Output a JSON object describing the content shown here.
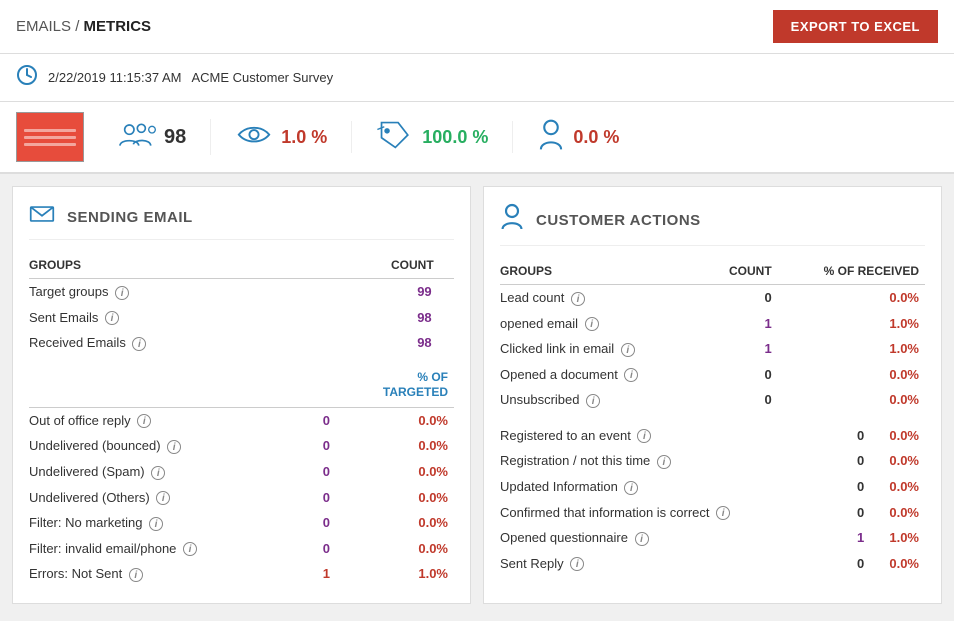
{
  "header": {
    "breadcrumb_emails": "EMAILS",
    "breadcrumb_sep": " /  ",
    "breadcrumb_metrics": "METRICS",
    "export_btn": "EXPORT TO EXCEL"
  },
  "info_bar": {
    "datetime": "2/22/2019  11:15:37 AM",
    "survey_name": "ACME Customer Survey"
  },
  "metrics": {
    "count": "98",
    "open_rate": "1.0 %",
    "click_rate": "100.0 %",
    "unsubscribe_rate": "0.0 %"
  },
  "sending_panel": {
    "title": "SENDING EMAIL",
    "groups_header": "GROUPS",
    "count_header": "COUNT",
    "rows": [
      {
        "label": "Target groups",
        "count": "99"
      },
      {
        "label": "Sent Emails",
        "count": "98"
      },
      {
        "label": "Received Emails",
        "count": "98"
      }
    ],
    "pct_header": "% OF TARGETED",
    "rows2": [
      {
        "label": "Out of office reply",
        "count": "0",
        "pct": "0.0%"
      },
      {
        "label": "Undelivered (bounced)",
        "count": "0",
        "pct": "0.0%"
      },
      {
        "label": "Undelivered (Spam)",
        "count": "0",
        "pct": "0.0%"
      },
      {
        "label": "Undelivered (Others)",
        "count": "0",
        "pct": "0.0%"
      },
      {
        "label": "Filter: No marketing",
        "count": "0",
        "pct": "0.0%"
      },
      {
        "label": "Filter: invalid email/phone",
        "count": "0",
        "pct": "0.0%"
      },
      {
        "label": "Errors: Not Sent",
        "count": "1",
        "pct": "1.0%"
      }
    ]
  },
  "customer_panel": {
    "title": "CUSTOMER ACTIONS",
    "groups_header": "GROUPS",
    "count_header": "COUNT",
    "pct_header": "% OF RECEIVED",
    "rows": [
      {
        "label": "Lead count",
        "count": "0",
        "pct": "0.0%"
      },
      {
        "label": "opened email",
        "count": "1",
        "pct": "1.0%"
      },
      {
        "label": "Clicked link in email",
        "count": "1",
        "pct": "1.0%"
      },
      {
        "label": "Opened a document",
        "count": "0",
        "pct": "0.0%"
      },
      {
        "label": "Unsubscribed",
        "count": "0",
        "pct": "0.0%"
      }
    ],
    "rows2": [
      {
        "label": "Registered to an event",
        "count": "0",
        "pct": "0.0%"
      },
      {
        "label": "Registration / not this time",
        "count": "0",
        "pct": "0.0%"
      },
      {
        "label": "Updated Information",
        "count": "0",
        "pct": "0.0%"
      },
      {
        "label": "Confirmed that information is correct",
        "count": "0",
        "pct": "0.0%"
      },
      {
        "label": "Opened questionnaire",
        "count": "1",
        "pct": "1.0%"
      },
      {
        "label": "Sent Reply",
        "count": "0",
        "pct": "0.0%"
      }
    ]
  }
}
